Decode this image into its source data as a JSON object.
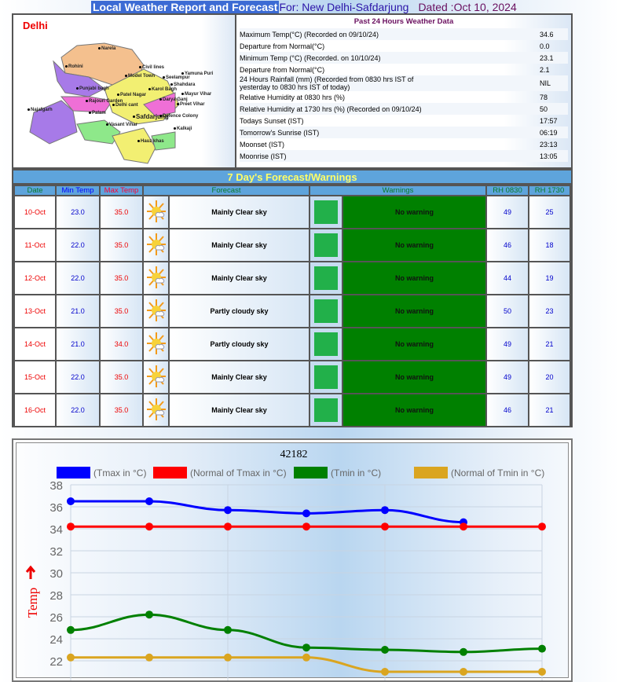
{
  "header": {
    "title": "Local Weather Report and Forecast",
    "for": "For: New Delhi-Safdarjung",
    "dated": "Dated :Oct 10, 2024"
  },
  "map": {
    "label": "Delhi",
    "districts": [
      "Narela",
      "Rohini",
      "Civil lines",
      "Model Town",
      "Seelampur",
      "Shahdara",
      "Mayur Vihar",
      "Punjabi bagh",
      "Patel Nagar",
      "Karol Bagh",
      "Rajouri Garden",
      "Delhi cant",
      "Darya Ganj",
      "Preet Vihar",
      "Najafgarh",
      "Palam",
      "Vasant Vihar",
      "Safdarjung",
      "Defence Colony",
      "Kalkaji",
      "Hauz khas",
      "Yamuna Puri"
    ]
  },
  "past24": {
    "title": "Past 24 Hours Weather Data",
    "rows": [
      {
        "label": "Maximum Temp(°C) (Recorded on 09/10/24)",
        "value": "34.6"
      },
      {
        "label": "Departure from Normal(°C)",
        "value": "0.0"
      },
      {
        "label": "Minimum Temp (°C) (Recorded. on 10/10/24)",
        "value": "23.1"
      },
      {
        "label": "Departure from Normal(°C)",
        "value": "2.1"
      },
      {
        "label": "24 Hours Rainfall (mm) (Recorded from 0830 hrs IST of yesterday to 0830 hrs IST of today)",
        "value": "NIL"
      },
      {
        "label": "Relative Humidity at 0830 hrs (%)",
        "value": "78"
      },
      {
        "label": "Relative Humidity at 1730 hrs (%) (Recorded on 09/10/24)",
        "value": "50"
      },
      {
        "label": "Todays Sunset (IST)",
        "value": "17:57"
      },
      {
        "label": "Tomorrow's Sunrise (IST)",
        "value": "06:19"
      },
      {
        "label": "Moonset (IST)",
        "value": "23:13"
      },
      {
        "label": "Moonrise (IST)",
        "value": "13:05"
      }
    ]
  },
  "forecast": {
    "title": "7 Day's Forecast/Warnings",
    "headers": [
      "Date",
      "Min Temp",
      "Max Temp",
      "Forecast",
      "Warnings",
      "RH 0830",
      "RH 1730"
    ],
    "warning_color": "#008000",
    "box_color": "#22b04a",
    "rows": [
      {
        "date": "10-Oct",
        "min": "23.0",
        "max": "35.0",
        "icon": "mainly-clear-icon",
        "forecast": "Mainly Clear sky",
        "warning": "No warning",
        "rh0830": "49",
        "rh1730": "25"
      },
      {
        "date": "11-Oct",
        "min": "22.0",
        "max": "35.0",
        "icon": "mainly-clear-icon",
        "forecast": "Mainly Clear sky",
        "warning": "No warning",
        "rh0830": "46",
        "rh1730": "18"
      },
      {
        "date": "12-Oct",
        "min": "22.0",
        "max": "35.0",
        "icon": "mainly-clear-icon",
        "forecast": "Mainly Clear sky",
        "warning": "No warning",
        "rh0830": "44",
        "rh1730": "19"
      },
      {
        "date": "13-Oct",
        "min": "21.0",
        "max": "35.0",
        "icon": "partly-cloudy-icon",
        "forecast": "Partly cloudy sky",
        "warning": "No warning",
        "rh0830": "50",
        "rh1730": "23"
      },
      {
        "date": "14-Oct",
        "min": "21.0",
        "max": "34.0",
        "icon": "partly-cloudy-icon",
        "forecast": "Partly cloudy sky",
        "warning": "No warning",
        "rh0830": "49",
        "rh1730": "21"
      },
      {
        "date": "15-Oct",
        "min": "22.0",
        "max": "35.0",
        "icon": "mainly-clear-icon",
        "forecast": "Mainly Clear sky",
        "warning": "No warning",
        "rh0830": "49",
        "rh1730": "20"
      },
      {
        "date": "16-Oct",
        "min": "22.0",
        "max": "35.0",
        "icon": "mainly-clear-icon",
        "forecast": "Mainly Clear sky",
        "warning": "No warning",
        "rh0830": "46",
        "rh1730": "21"
      }
    ]
  },
  "chart_data": {
    "type": "line",
    "title": "42182",
    "ylabel": "Temp",
    "ylim": [
      22,
      38
    ],
    "yticks": [
      22,
      24,
      26,
      28,
      30,
      32,
      34,
      36,
      38
    ],
    "grid": true,
    "legend": "top",
    "series": [
      {
        "name": "(Tmax in °C)",
        "color": "#0000ff",
        "values": [
          36.5,
          36.5,
          35.7,
          35.4,
          35.7,
          34.6
        ]
      },
      {
        "name": "(Normal of Tmax in °C)",
        "color": "#ff0000",
        "values": [
          34.2,
          34.2,
          34.2,
          34.2,
          34.2,
          34.2,
          34.2
        ]
      },
      {
        "name": "(Tmin in °C)",
        "color": "#008000",
        "values": [
          24.8,
          26.2,
          24.8,
          23.2,
          23.0,
          22.8,
          23.1
        ]
      },
      {
        "name": "(Normal of Tmin in °C)",
        "color": "#daa520",
        "values": [
          22.3,
          22.3,
          22.3,
          22.3,
          21.0,
          21.0,
          21.0
        ]
      }
    ]
  }
}
